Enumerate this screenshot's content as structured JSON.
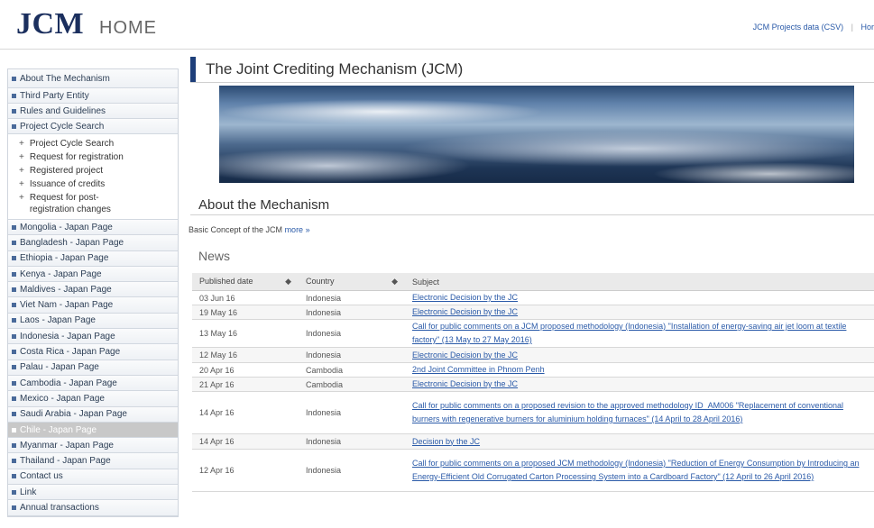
{
  "header": {
    "logo": "JCM",
    "home": "HOME",
    "links": [
      "JCM Projects data (CSV)",
      "Hor"
    ]
  },
  "sidebar": {
    "items_top": [
      {
        "label": "About The Mechanism"
      },
      {
        "label": "Third Party Entity"
      },
      {
        "label": "Rules and Guidelines"
      },
      {
        "label": "Project Cycle Search"
      }
    ],
    "subitems": [
      {
        "label": "Project Cycle Search"
      },
      {
        "label": "Request for registration"
      },
      {
        "label": "Registered project"
      },
      {
        "label": "Issuance of credits"
      },
      {
        "label": "Request for post-registration changes"
      }
    ],
    "items_bottom": [
      {
        "label": "Mongolia - Japan Page"
      },
      {
        "label": "Bangladesh - Japan Page"
      },
      {
        "label": "Ethiopia - Japan Page"
      },
      {
        "label": "Kenya - Japan Page"
      },
      {
        "label": "Maldives - Japan Page"
      },
      {
        "label": "Viet Nam - Japan Page"
      },
      {
        "label": "Laos - Japan Page"
      },
      {
        "label": "Indonesia - Japan Page"
      },
      {
        "label": "Costa Rica - Japan Page"
      },
      {
        "label": "Palau - Japan Page"
      },
      {
        "label": "Cambodia - Japan Page"
      },
      {
        "label": "Mexico - Japan Page"
      },
      {
        "label": "Saudi Arabia - Japan Page"
      },
      {
        "label": "Chile - Japan Page",
        "active": true
      },
      {
        "label": "Myanmar - Japan Page"
      },
      {
        "label": "Thailand - Japan Page"
      },
      {
        "label": "Contact us"
      },
      {
        "label": "Link"
      },
      {
        "label": "Annual transactions"
      }
    ]
  },
  "main": {
    "title": "The Joint Crediting Mechanism (JCM)",
    "about_heading": "About the Mechanism",
    "basic_text": "Basic Concept of the JCM",
    "more_link": "more »",
    "news_heading": "News",
    "news_columns": [
      "Published date",
      "Country",
      "Subject"
    ],
    "news_rows": [
      {
        "date": "03 Jun 16",
        "country": "Indonesia",
        "subject": "Electronic Decision by the JC"
      },
      {
        "date": "19 May 16",
        "country": "Indonesia",
        "subject": "Electronic Decision by the JC"
      },
      {
        "date": "13 May 16",
        "country": "Indonesia",
        "subject": "Call for public comments on a JCM proposed methodology (Indonesia) \"Installation of energy-saving air jet loom at textile factory\" (13 May to 27 May 2016)"
      },
      {
        "date": "12 May 16",
        "country": "Indonesia",
        "subject": "Electronic Decision by the JC"
      },
      {
        "date": "20 Apr 16",
        "country": "Cambodia",
        "subject": "2nd Joint Committee in Phnom Penh"
      },
      {
        "date": "21 Apr 16",
        "country": "Cambodia",
        "subject": "Electronic Decision by the JC"
      },
      {
        "date": "14 Apr 16",
        "country": "Indonesia",
        "subject": "Call for public comments on a proposed revision to the approved methodology ID_AM006 \"Replacement of conventional burners with regenerative burners for aluminium holding furnaces\" (14 April to 28 April 2016)"
      },
      {
        "date": "14 Apr 16",
        "country": "Indonesia",
        "subject": "Decision by the JC"
      },
      {
        "date": "12 Apr 16",
        "country": "Indonesia",
        "subject": "Call for public comments on a proposed JCM methodology (Indonesia) \"Reduction of Energy Consumption by Introducing an Energy-Efficient Old Corrugated Carton Processing System into a Cardboard Factory\" (12 April to 26 April 2016)"
      }
    ]
  },
  "colors": {
    "brand": "#1b2f5e",
    "accent": "#1e3f7a",
    "link": "#2a5aa8"
  }
}
